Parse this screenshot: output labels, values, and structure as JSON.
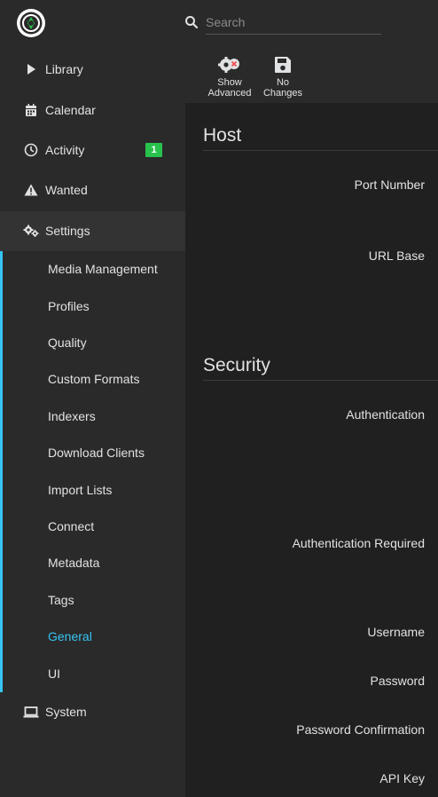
{
  "search": {
    "placeholder": "Search"
  },
  "sidebar": {
    "items": [
      {
        "label": "Library",
        "icon": "play-icon"
      },
      {
        "label": "Calendar",
        "icon": "calendar-icon"
      },
      {
        "label": "Activity",
        "icon": "clock-icon",
        "badge": "1"
      },
      {
        "label": "Wanted",
        "icon": "warning-icon"
      },
      {
        "label": "Settings",
        "icon": "gears-icon"
      },
      {
        "label": "System",
        "icon": "laptop-icon"
      }
    ],
    "settings_sub": [
      "Media Management",
      "Profiles",
      "Quality",
      "Custom Formats",
      "Indexers",
      "Download Clients",
      "Import Lists",
      "Connect",
      "Metadata",
      "Tags",
      "General",
      "UI"
    ],
    "active_sub": "General"
  },
  "toolbar": {
    "show_advanced_line1": "Show",
    "show_advanced_line2": "Advanced",
    "no_changes_line1": "No",
    "no_changes_line2": "Changes"
  },
  "sections": {
    "host": {
      "title": "Host",
      "fields": [
        "Port Number",
        "URL Base"
      ]
    },
    "security": {
      "title": "Security",
      "fields": [
        "Authentication",
        "Authentication Required",
        "Username",
        "Password",
        "Password Confirmation",
        "API Key"
      ]
    }
  },
  "colors": {
    "accent": "#35c5f4",
    "badge": "#27c24c",
    "sidebar_bg": "#2a2a2a",
    "content_bg": "#202020"
  }
}
